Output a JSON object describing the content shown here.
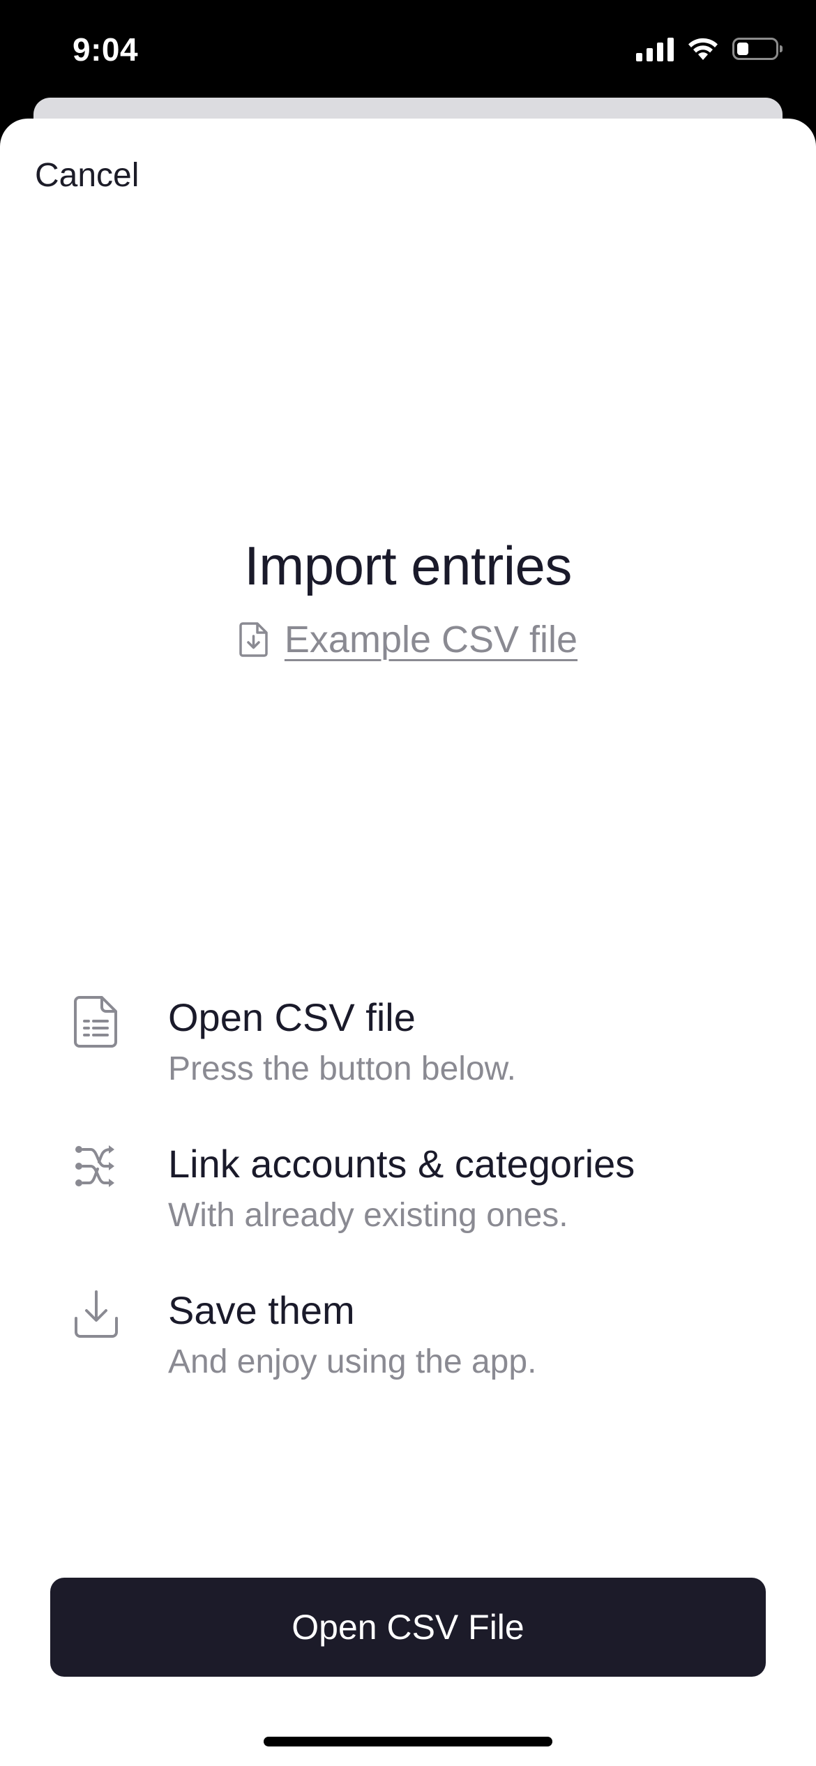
{
  "status_bar": {
    "time": "9:04",
    "icons": [
      "cellular-signal-icon",
      "wifi-icon",
      "battery-icon"
    ],
    "battery_level": 0.3
  },
  "sheet": {
    "cancel_label": "Cancel",
    "title": "Import entries",
    "example_link": {
      "icon": "document-download-icon",
      "label": "Example CSV file"
    },
    "steps": [
      {
        "icon": "document-lines-icon",
        "title": "Open CSV file",
        "description": "Press the button below."
      },
      {
        "icon": "link-arrows-icon",
        "title": "Link accounts & categories",
        "description": "With already existing ones."
      },
      {
        "icon": "download-tray-icon",
        "title": "Save them",
        "description": "And enjoy using the app."
      }
    ],
    "primary_button_label": "Open CSV File"
  },
  "colors": {
    "text_primary": "#1a1a2a",
    "text_secondary": "#8a8a92",
    "button_background": "#1c1b29",
    "sheet_background": "#ffffff"
  }
}
